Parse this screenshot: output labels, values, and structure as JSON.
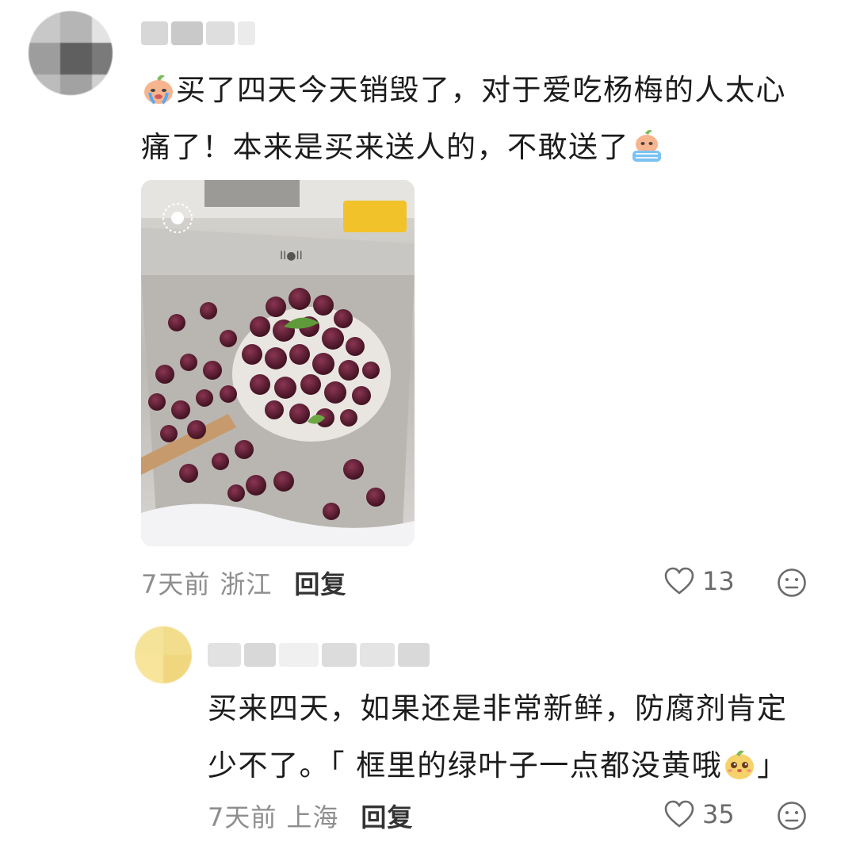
{
  "comments": [
    {
      "text_line1": "买了四天今天销毁了，对于爱吃杨梅的人太心",
      "text_line2": "痛了！本来是买来送人的，不敢送了",
      "time": "7天前",
      "location": "浙江",
      "reply_label": "回复",
      "likes": "13",
      "icons": {
        "like": "heart-outline-icon",
        "reaction": "neutral-face-icon",
        "emoji_a": "crying-peach-emoji",
        "emoji_b": "crying-peach-emoji"
      }
    },
    {
      "text_line1": "买来四天，如果还是非常新鲜，防腐剂肯定",
      "text_line2": "少不了。「 框里的绿叶子一点都没黄哦",
      "text_close": "」",
      "time": "7天前",
      "location": "上海",
      "reply_label": "回复",
      "likes": "35",
      "icons": {
        "like": "heart-outline-icon",
        "reaction": "neutral-face-icon",
        "emoji": "cute-puppy-emoji"
      }
    }
  ],
  "colors": {
    "text": "#1c1c1c",
    "meta": "#8e8e8e",
    "reply": "#333333"
  }
}
